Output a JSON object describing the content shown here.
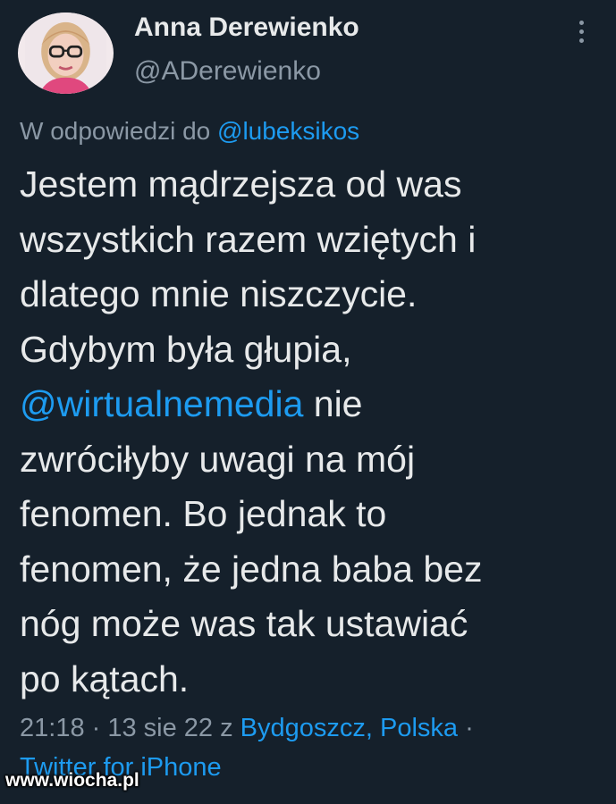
{
  "author": {
    "display_name": "Anna Derewienko",
    "handle": "@ADerewienko",
    "avatar_icon": "user-avatar-photo"
  },
  "reply": {
    "prefix": "W odpowiedzi do",
    "mention": "@lubeksikos"
  },
  "tweet": {
    "lines": [
      "Jestem mądrzejsza od was",
      "wszystkich razem wziętych i",
      "dlatego mnie niszczycie.",
      "Gdybym była głupia,",
      "",
      "zwróciłyby uwagi na mój",
      "fenomen. Bo jednak to",
      "fenomen, że jedna baba bez",
      "nóg może was tak ustawiać",
      "po kątach."
    ],
    "mention": "@wirtualnemedia",
    "mention_tail": " nie"
  },
  "meta": {
    "time_date": "21:18 · 13 sie 22 z ",
    "location": "Bydgoszcz, Polska",
    "separator": " ·",
    "source": "Twitter for iPhone"
  },
  "watermark": "www.wiocha.pl",
  "colors": {
    "background": "#15202b",
    "text": "#e7e9ea",
    "muted": "#8b98a5",
    "link": "#1d9bf0"
  }
}
